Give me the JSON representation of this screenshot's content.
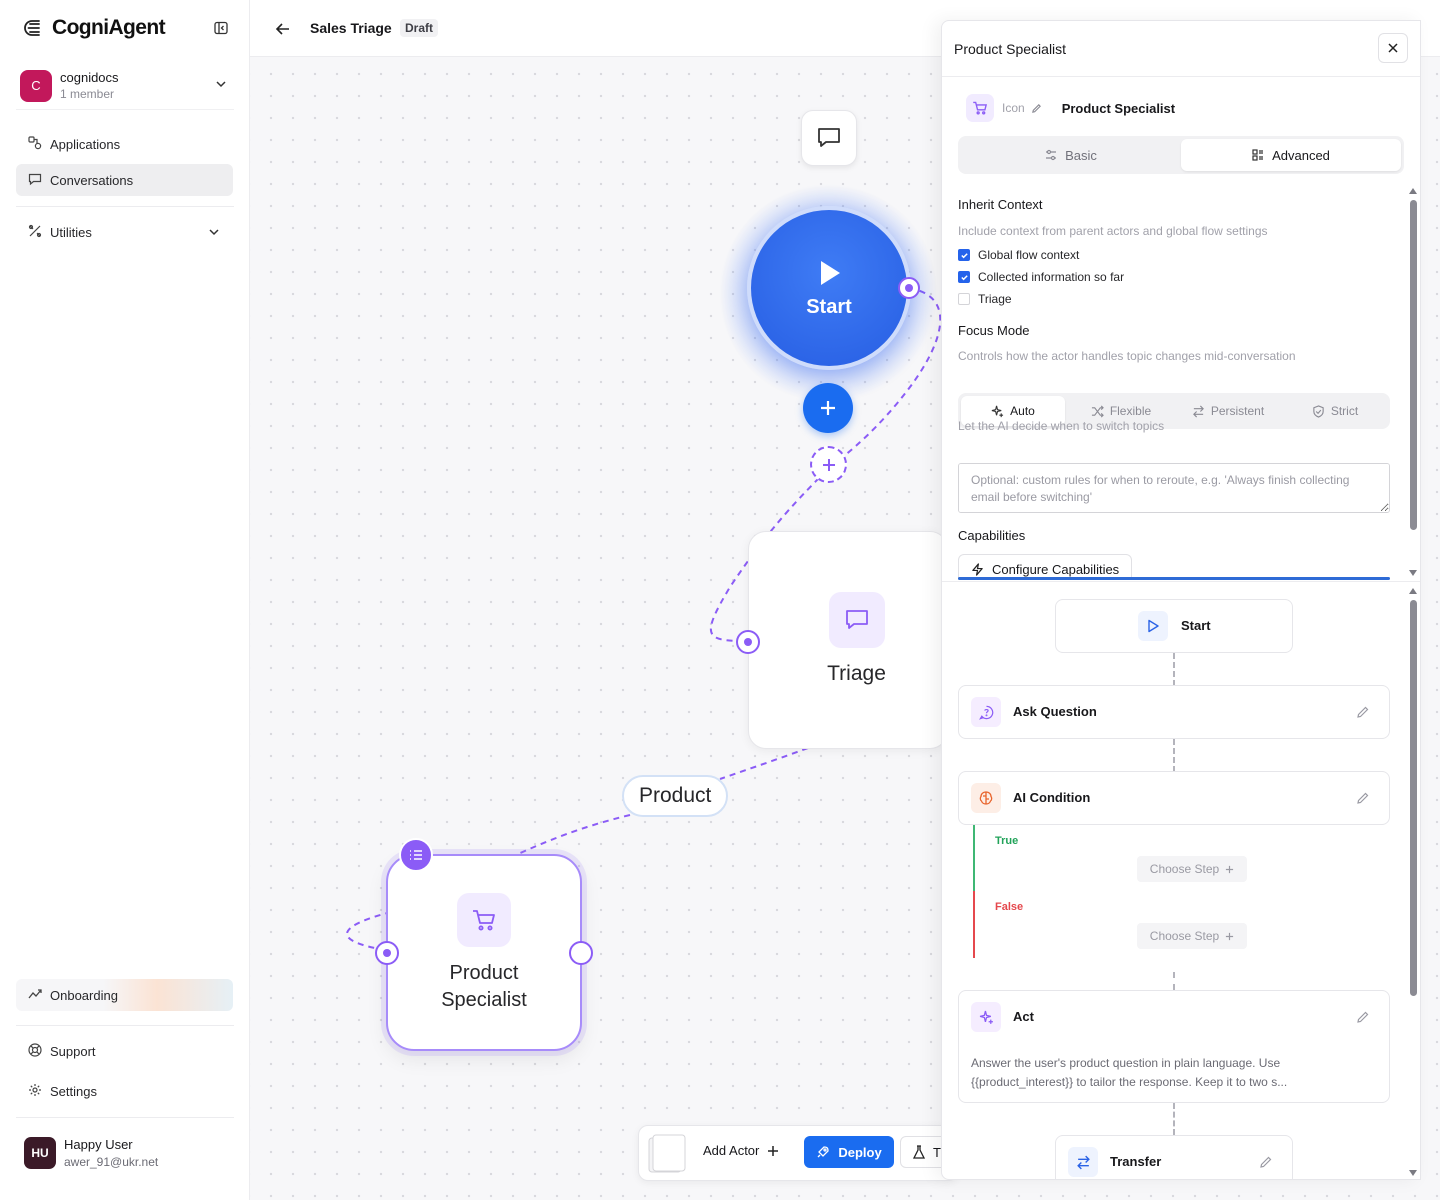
{
  "brand": {
    "name": "CogniAgent"
  },
  "org": {
    "initial": "C",
    "name": "cognidocs",
    "members": "1 member"
  },
  "nav": {
    "applications": "Applications",
    "conversations": "Conversations",
    "utilities": "Utilities",
    "onboarding": "Onboarding",
    "support": "Support",
    "settings": "Settings"
  },
  "user": {
    "initials": "HU",
    "name": "Happy User",
    "email": "awer_91@ukr.net"
  },
  "header": {
    "title": "Sales Triage",
    "status": "Draft"
  },
  "canvas": {
    "start_label": "Start",
    "triage_label": "Triage",
    "edge_label": "Product",
    "product_line1": "Product",
    "product_line2": "Specialist"
  },
  "toolbar": {
    "add_actor": "Add Actor",
    "deploy": "Deploy",
    "test": "T"
  },
  "panel": {
    "title": "Product Specialist",
    "icon_label": "Icon",
    "actor_name": "Product Specialist",
    "tabs": {
      "basic": "Basic",
      "advanced": "Advanced"
    },
    "inherit": {
      "title": "Inherit Context",
      "desc": "Include context from parent actors and global flow settings",
      "options": [
        {
          "label": "Global flow context",
          "checked": true
        },
        {
          "label": "Collected information so far",
          "checked": true
        },
        {
          "label": "Triage",
          "checked": false
        }
      ]
    },
    "focus": {
      "title": "Focus Mode",
      "desc": "Controls how the actor handles topic changes mid-conversation",
      "modes": [
        "Auto",
        "Flexible",
        "Persistent",
        "Strict"
      ],
      "selected": "Auto",
      "hint": "Let the AI decide when to switch topics",
      "placeholder": "Optional: custom rules for when to reroute, e.g. 'Always finish collecting email before switching'"
    },
    "capabilities": {
      "title": "Capabilities",
      "button": "Configure Capabilities"
    },
    "steps": {
      "start": "Start",
      "ask": "Ask Question",
      "condition": "AI Condition",
      "true_label": "True",
      "false_label": "False",
      "choose_step": "Choose Step",
      "act": "Act",
      "act_desc_1": "Answer the user's product question in plain language. Use",
      "act_desc_2": "{{product_interest}} to tailor the response. Keep it to two s...",
      "transfer": "Transfer"
    }
  },
  "colors": {
    "accent": "#1a6cf0",
    "violet": "#8b5cf6",
    "true": "#22a35a",
    "false": "#e5484d"
  }
}
